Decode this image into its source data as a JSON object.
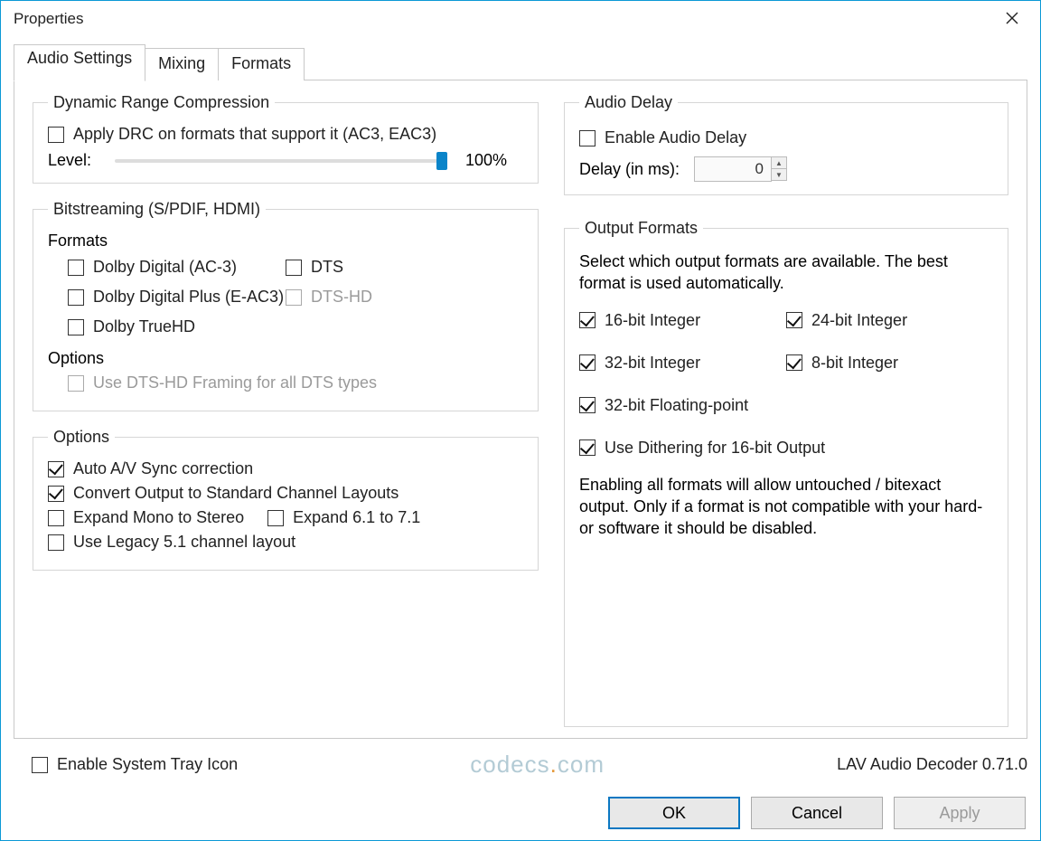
{
  "window": {
    "title": "Properties"
  },
  "tabs": [
    "Audio Settings",
    "Mixing",
    "Formats"
  ],
  "drc": {
    "legend": "Dynamic Range Compression",
    "apply": "Apply DRC on formats that support it (AC3, EAC3)",
    "level_label": "Level:",
    "level_value": "100%"
  },
  "bitstream": {
    "legend": "Bitstreaming (S/PDIF, HDMI)",
    "formats_label": "Formats",
    "dolby_ac3": "Dolby Digital (AC-3)",
    "dts": "DTS",
    "dolby_eac3": "Dolby Digital Plus (E-AC3)",
    "dts_hd": "DTS-HD",
    "dolby_truehd": "Dolby TrueHD",
    "options_label": "Options",
    "dts_hd_framing": "Use DTS-HD Framing for all DTS types"
  },
  "options": {
    "legend": "Options",
    "auto_av": "Auto A/V Sync correction",
    "convert_std": "Convert Output to Standard Channel Layouts",
    "expand_mono": "Expand Mono to Stereo",
    "expand_61": "Expand 6.1 to 7.1",
    "legacy_51": "Use Legacy 5.1 channel layout"
  },
  "delay": {
    "legend": "Audio Delay",
    "enable": "Enable Audio Delay",
    "delay_label": "Delay (in ms):",
    "delay_value": "0"
  },
  "output": {
    "legend": "Output Formats",
    "desc": "Select which output formats are available. The best format is used automatically.",
    "int16": "16-bit Integer",
    "int24": "24-bit Integer",
    "int32": "32-bit Integer",
    "int8": "8-bit Integer",
    "fp32": "32-bit Floating-point",
    "dither": "Use Dithering for 16-bit Output",
    "note": "Enabling all formats will allow untouched / bitexact output. Only if a format is not compatible with your hard- or software it should be disabled."
  },
  "tray": "Enable System Tray Icon",
  "watermark": {
    "a": "codecs",
    "b": ".",
    "c": "com"
  },
  "version": "LAV Audio Decoder 0.71.0",
  "buttons": {
    "ok": "OK",
    "cancel": "Cancel",
    "apply": "Apply"
  }
}
